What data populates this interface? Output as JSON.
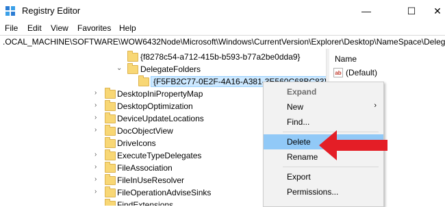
{
  "window": {
    "title": "Registry Editor",
    "minimize_glyph": "—",
    "maximize_glyph": "☐",
    "close_glyph": "✕"
  },
  "menubar": {
    "items": [
      "File",
      "Edit",
      "View",
      "Favorites",
      "Help"
    ]
  },
  "address": {
    "path": ".OCAL_MACHINE\\SOFTWARE\\WOW6432Node\\Microsoft\\Windows\\CurrentVersion\\Explorer\\Desktop\\NameSpace\\DelegateFolders"
  },
  "tree": {
    "items": [
      {
        "label": "{f8278c54-a712-415b-b593-b77a2be0dda9}",
        "expanded": false
      },
      {
        "label": "DelegateFolders",
        "expanded": true
      },
      {
        "label": "{F5FB2C77-0E2F-4A16-A381-3E560C68BC83}",
        "selected": true
      },
      {
        "label": "DesktopIniPropertyMap"
      },
      {
        "label": "DesktopOptimization"
      },
      {
        "label": "DeviceUpdateLocations"
      },
      {
        "label": "DocObjectView"
      },
      {
        "label": "DriveIcons"
      },
      {
        "label": "ExecuteTypeDelegates"
      },
      {
        "label": "FileAssociation"
      },
      {
        "label": "FileInUseResolver"
      },
      {
        "label": "FileOperationAdviseSinks"
      },
      {
        "label": "FindExtensions"
      }
    ],
    "expand_glyph": "›",
    "collapse_glyph": "⌄"
  },
  "values_pane": {
    "column_name": "Name",
    "rows": [
      {
        "icon": "string-value-icon",
        "icon_text": "ab",
        "name": "(Default)"
      }
    ]
  },
  "context_menu": {
    "items": [
      {
        "label": "Expand",
        "header": true
      },
      {
        "label": "New",
        "submenu": true
      },
      {
        "label": "Find..."
      },
      {
        "label": "Delete",
        "highlighted": true
      },
      {
        "label": "Rename"
      },
      {
        "label": "Export"
      },
      {
        "label": "Permissions..."
      }
    ],
    "submenu_glyph": "›"
  },
  "annotation": {
    "arrow_color": "#e41e26",
    "points_to": "Delete"
  },
  "colors": {
    "selection": "#cce8ff",
    "menu_hover": "#91c9f7",
    "folder": "#f8d775"
  }
}
